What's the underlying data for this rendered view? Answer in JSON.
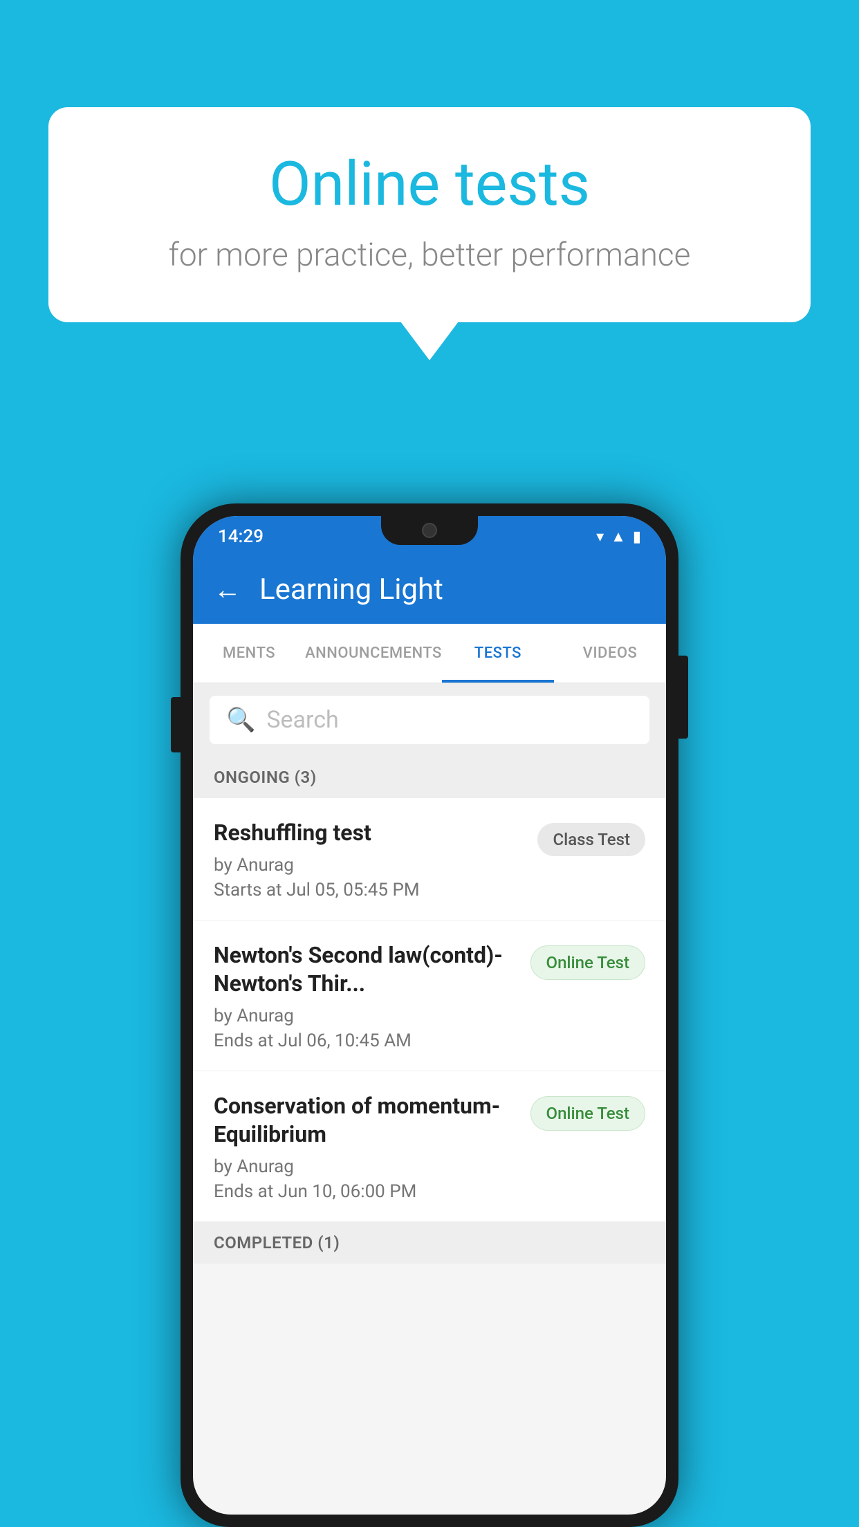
{
  "background_color": "#1bb8e0",
  "bubble": {
    "title": "Online tests",
    "subtitle": "for more practice, better performance"
  },
  "phone": {
    "status_bar": {
      "time": "14:29",
      "icons": [
        "wifi",
        "signal",
        "battery"
      ]
    },
    "header": {
      "title": "Learning Light",
      "back_label": "←"
    },
    "tabs": [
      {
        "label": "MENTS",
        "active": false
      },
      {
        "label": "ANNOUNCEMENTS",
        "active": false
      },
      {
        "label": "TESTS",
        "active": true
      },
      {
        "label": "VIDEOS",
        "active": false
      }
    ],
    "search": {
      "placeholder": "Search"
    },
    "ongoing_section": {
      "label": "ONGOING (3)"
    },
    "tests": [
      {
        "name": "Reshuffling test",
        "by": "by Anurag",
        "time": "Starts at  Jul 05, 05:45 PM",
        "badge": "Class Test",
        "badge_type": "class"
      },
      {
        "name": "Newton's Second law(contd)-Newton's Thir...",
        "by": "by Anurag",
        "time": "Ends at  Jul 06, 10:45 AM",
        "badge": "Online Test",
        "badge_type": "online"
      },
      {
        "name": "Conservation of momentum-Equilibrium",
        "by": "by Anurag",
        "time": "Ends at  Jun 10, 06:00 PM",
        "badge": "Online Test",
        "badge_type": "online"
      }
    ],
    "completed_section": {
      "label": "COMPLETED (1)"
    }
  }
}
